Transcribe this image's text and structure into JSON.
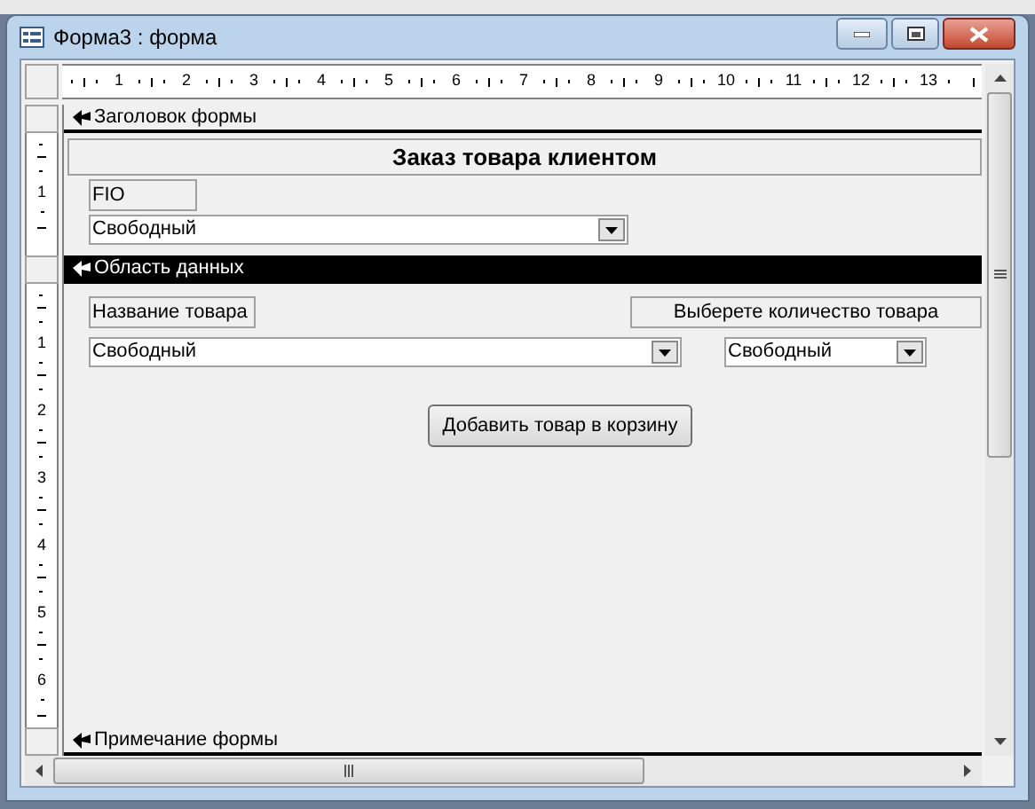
{
  "window": {
    "title": "Форма3 : форма"
  },
  "ruler": {
    "horizontal": [
      "1",
      "2",
      "3",
      "4",
      "5",
      "6",
      "7",
      "8",
      "9",
      "10",
      "11",
      "12",
      "13"
    ]
  },
  "sections": [
    {
      "title": "Заголовок формы",
      "selected": false,
      "ruler": [
        "1"
      ],
      "controls": [
        {
          "kind": "title_label",
          "text": "Заказ товара клиентом"
        },
        {
          "kind": "label",
          "text": "FIO"
        },
        {
          "kind": "combo",
          "value": "Свободный"
        }
      ]
    },
    {
      "title": "Область данных",
      "selected": true,
      "ruler": [
        "1",
        "2",
        "3",
        "4",
        "5",
        "6"
      ],
      "controls": [
        {
          "kind": "label",
          "text": "Название товара"
        },
        {
          "kind": "label",
          "text": "Выберете количество товара"
        },
        {
          "kind": "combo",
          "value": "Свободный"
        },
        {
          "kind": "combo",
          "value": "Свободный"
        },
        {
          "kind": "button",
          "text": "Добавить товар в корзину"
        }
      ]
    },
    {
      "title": "Примечание формы",
      "selected": false
    }
  ]
}
